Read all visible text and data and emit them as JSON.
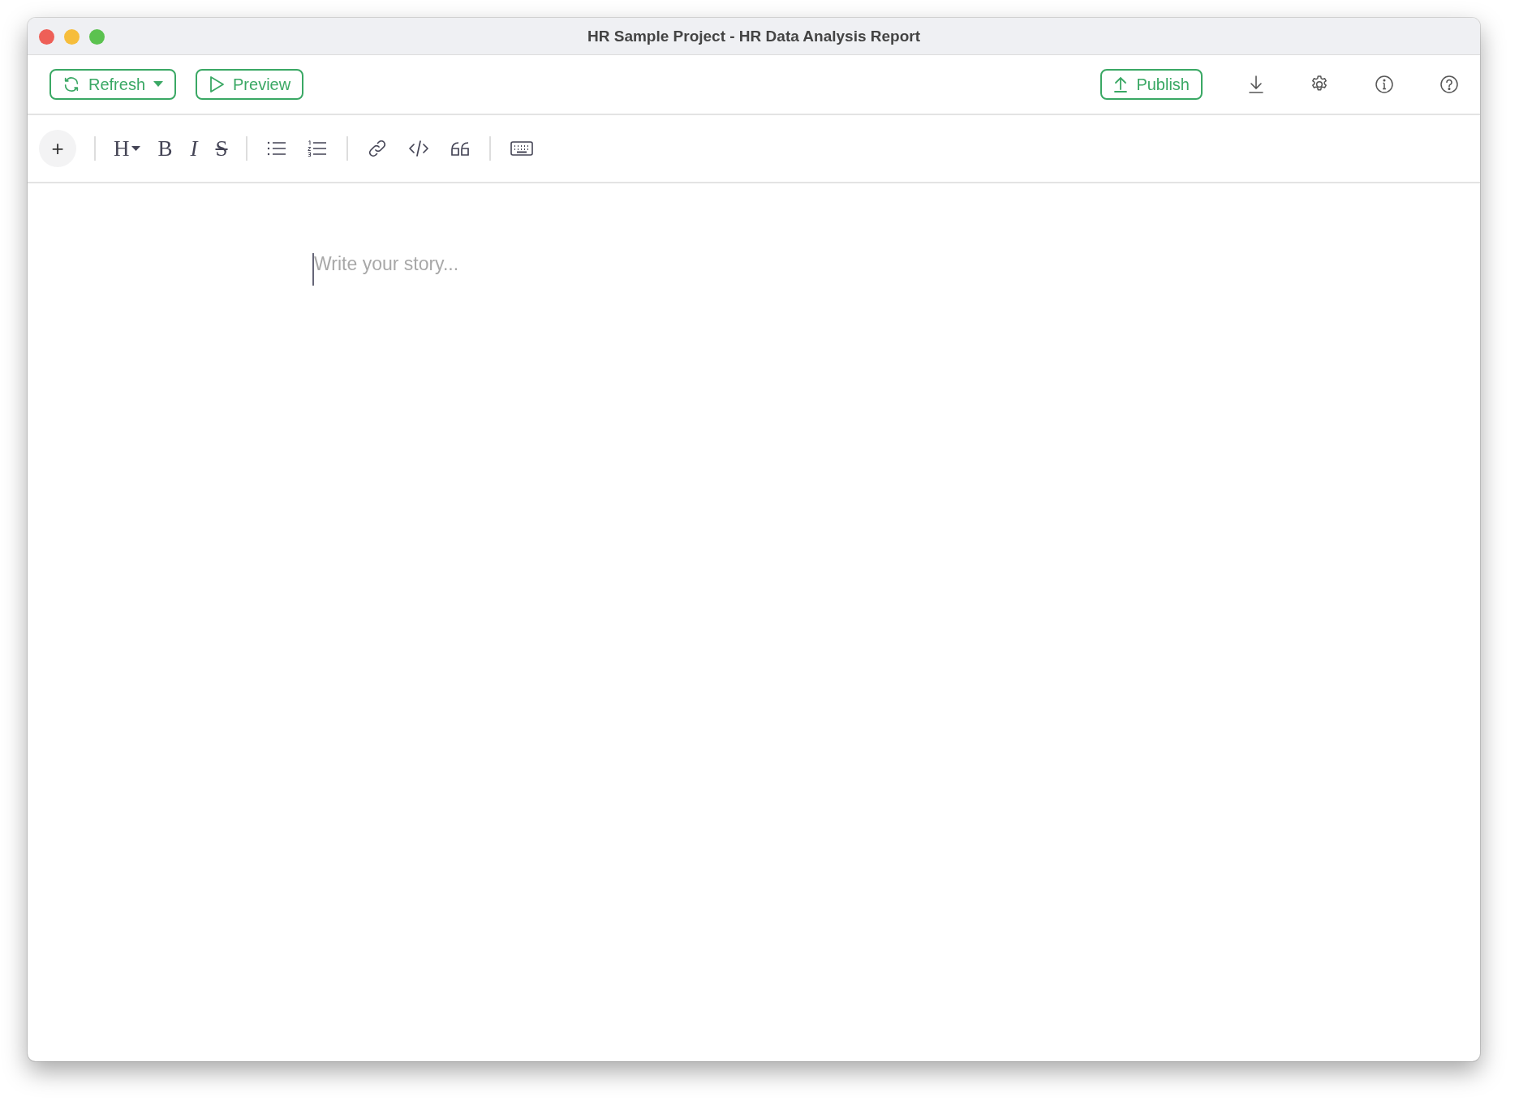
{
  "window": {
    "title": "HR Sample Project - HR Data Analysis Report"
  },
  "toolbar": {
    "refresh": "Refresh",
    "preview": "Preview",
    "publish": "Publish"
  },
  "format_toolbar": {
    "add": "+",
    "heading": "H",
    "bold": "B",
    "italic": "I",
    "strikethrough": "S"
  },
  "editor": {
    "placeholder": "Write your story..."
  }
}
